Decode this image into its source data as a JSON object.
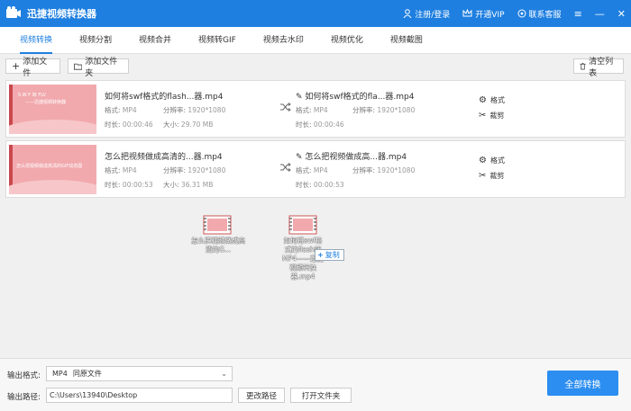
{
  "app": {
    "title": "迅捷视频转换器"
  },
  "titlebar": {
    "login": "注册/登录",
    "vip": "开通VIP",
    "service": "联系客服"
  },
  "tabs": [
    "视频转换",
    "视频分割",
    "视频合并",
    "视频转GIF",
    "视频去水印",
    "视频优化",
    "视频截图"
  ],
  "toolbar": {
    "add_file": "添加文件",
    "add_folder": "添加文件夹",
    "clear_list": "清空列表"
  },
  "labels": {
    "format": "格式:",
    "resolution": "分辨率:",
    "duration": "时长:",
    "size": "大小:"
  },
  "files": [
    {
      "name": "如何将swf格式的flash...器.mp4",
      "format": "MP4",
      "resolution": "1920*1080",
      "duration": "00:00:46",
      "size": "29.70 MB",
      "out_name": "如何将swf格式的fla...器.mp4",
      "out_format": "MP4",
      "out_resolution": "1920*1080",
      "out_duration": "00:00:46",
      "thumb_line1": "S W F 转 FLV",
      "thumb_line2": "——迅捷视频转换器"
    },
    {
      "name": "怎么把视频做成高清的...器.mp4",
      "format": "MP4",
      "resolution": "1920*1080",
      "duration": "00:00:53",
      "size": "36.31 MB",
      "out_name": "怎么把视频做成高...器.mp4",
      "out_format": "MP4",
      "out_resolution": "1920*1080",
      "out_duration": "00:00:53",
      "thumb_line1": "怎么把视频做成高清的GIF动态图",
      "thumb_line2": ""
    }
  ],
  "actions": {
    "format": "格式",
    "cut": "裁剪"
  },
  "drag": {
    "item1": "怎么把视频做成高清的G...",
    "item2": "如何将swf格式的flash转MP4——迅捷视频转换器.mp4",
    "copy": "复制"
  },
  "bottom": {
    "output_format_label": "输出格式:",
    "output_format_value": "MP4",
    "output_format_sub": "同原文件",
    "output_path_label": "输出路径:",
    "output_path_value": "C:\\Users\\13940\\Desktop",
    "change_path": "更改路径",
    "open_folder": "打开文件夹",
    "convert_all": "全部转换"
  },
  "colors": {
    "accent": "#1e7fe0",
    "thumb": "#f1a9ad"
  }
}
